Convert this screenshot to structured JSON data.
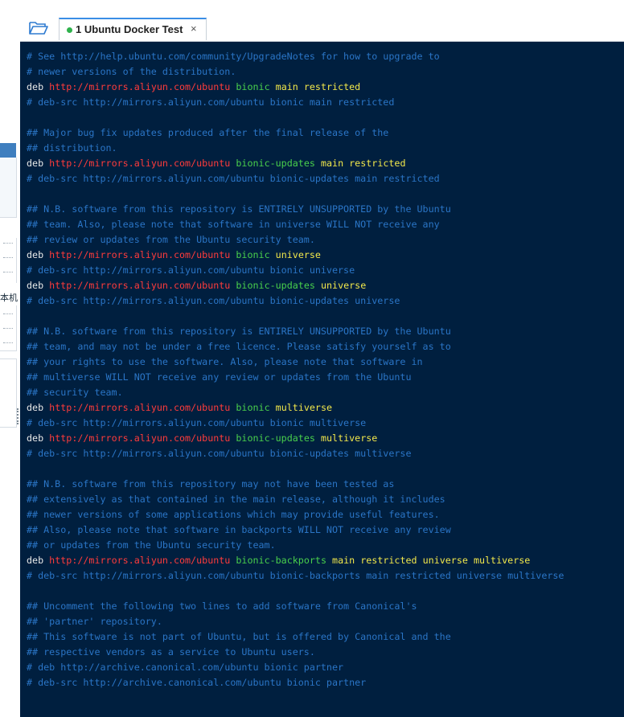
{
  "tab": {
    "index": "1",
    "title": "Ubuntu Docker Test",
    "close": "×",
    "status_color": "#2fb24c"
  },
  "left_panel": {
    "partial_text": "本机"
  },
  "terminal": {
    "lines": [
      {
        "type": "comment",
        "text": "# See http://help.ubuntu.com/community/UpgradeNotes for how to upgrade to"
      },
      {
        "type": "comment",
        "text": "# newer versions of the distribution."
      },
      {
        "type": "deb",
        "kw": "deb",
        "url": "http://mirrors.aliyun.com/ubuntu",
        "dist": "bionic",
        "comp": "main restricted"
      },
      {
        "type": "comment",
        "text": "# deb-src http://mirrors.aliyun.com/ubuntu bionic main restricted"
      },
      {
        "type": "blank",
        "text": ""
      },
      {
        "type": "comment",
        "text": "## Major bug fix updates produced after the final release of the"
      },
      {
        "type": "comment",
        "text": "## distribution."
      },
      {
        "type": "deb",
        "kw": "deb",
        "url": "http://mirrors.aliyun.com/ubuntu",
        "dist": "bionic-updates",
        "comp": "main restricted"
      },
      {
        "type": "comment",
        "text": "# deb-src http://mirrors.aliyun.com/ubuntu bionic-updates main restricted"
      },
      {
        "type": "blank",
        "text": ""
      },
      {
        "type": "comment",
        "text": "## N.B. software from this repository is ENTIRELY UNSUPPORTED by the Ubuntu"
      },
      {
        "type": "comment",
        "text": "## team. Also, please note that software in universe WILL NOT receive any"
      },
      {
        "type": "comment",
        "text": "## review or updates from the Ubuntu security team."
      },
      {
        "type": "deb",
        "kw": "deb",
        "url": "http://mirrors.aliyun.com/ubuntu",
        "dist": "bionic",
        "comp": "universe"
      },
      {
        "type": "comment",
        "text": "# deb-src http://mirrors.aliyun.com/ubuntu bionic universe"
      },
      {
        "type": "deb",
        "kw": "deb",
        "url": "http://mirrors.aliyun.com/ubuntu",
        "dist": "bionic-updates",
        "comp": "universe"
      },
      {
        "type": "comment",
        "text": "# deb-src http://mirrors.aliyun.com/ubuntu bionic-updates universe"
      },
      {
        "type": "blank",
        "text": ""
      },
      {
        "type": "comment",
        "text": "## N.B. software from this repository is ENTIRELY UNSUPPORTED by the Ubuntu"
      },
      {
        "type": "comment",
        "text": "## team, and may not be under a free licence. Please satisfy yourself as to"
      },
      {
        "type": "comment",
        "text": "## your rights to use the software. Also, please note that software in"
      },
      {
        "type": "comment",
        "text": "## multiverse WILL NOT receive any review or updates from the Ubuntu"
      },
      {
        "type": "comment",
        "text": "## security team."
      },
      {
        "type": "deb",
        "kw": "deb",
        "url": "http://mirrors.aliyun.com/ubuntu",
        "dist": "bionic",
        "comp": "multiverse"
      },
      {
        "type": "comment",
        "text": "# deb-src http://mirrors.aliyun.com/ubuntu bionic multiverse"
      },
      {
        "type": "deb",
        "kw": "deb",
        "url": "http://mirrors.aliyun.com/ubuntu",
        "dist": "bionic-updates",
        "comp": "multiverse"
      },
      {
        "type": "comment",
        "text": "# deb-src http://mirrors.aliyun.com/ubuntu bionic-updates multiverse"
      },
      {
        "type": "blank",
        "text": ""
      },
      {
        "type": "comment",
        "text": "## N.B. software from this repository may not have been tested as"
      },
      {
        "type": "comment",
        "text": "## extensively as that contained in the main release, although it includes"
      },
      {
        "type": "comment",
        "text": "## newer versions of some applications which may provide useful features."
      },
      {
        "type": "comment",
        "text": "## Also, please note that software in backports WILL NOT receive any review"
      },
      {
        "type": "comment",
        "text": "## or updates from the Ubuntu security team."
      },
      {
        "type": "deb",
        "kw": "deb",
        "url": "http://mirrors.aliyun.com/ubuntu",
        "dist": "bionic-backports",
        "comp": "main restricted universe multiverse"
      },
      {
        "type": "comment",
        "text": "# deb-src http://mirrors.aliyun.com/ubuntu bionic-backports main restricted universe multiverse"
      },
      {
        "type": "blank",
        "text": ""
      },
      {
        "type": "comment",
        "text": "## Uncomment the following two lines to add software from Canonical's"
      },
      {
        "type": "comment",
        "text": "## 'partner' repository."
      },
      {
        "type": "comment",
        "text": "## This software is not part of Ubuntu, but is offered by Canonical and the"
      },
      {
        "type": "comment",
        "text": "## respective vendors as a service to Ubuntu users."
      },
      {
        "type": "comment",
        "text": "# deb http://archive.canonical.com/ubuntu bionic partner"
      },
      {
        "type": "comment",
        "text": "# deb-src http://archive.canonical.com/ubuntu bionic partner"
      }
    ]
  },
  "colors": {
    "terminal_bg": "#001f3f",
    "comment": "#2a75c6",
    "url": "#ff3b3b",
    "dist": "#49d04c",
    "components": "#f2e84b",
    "accent": "#3a8ee6"
  }
}
